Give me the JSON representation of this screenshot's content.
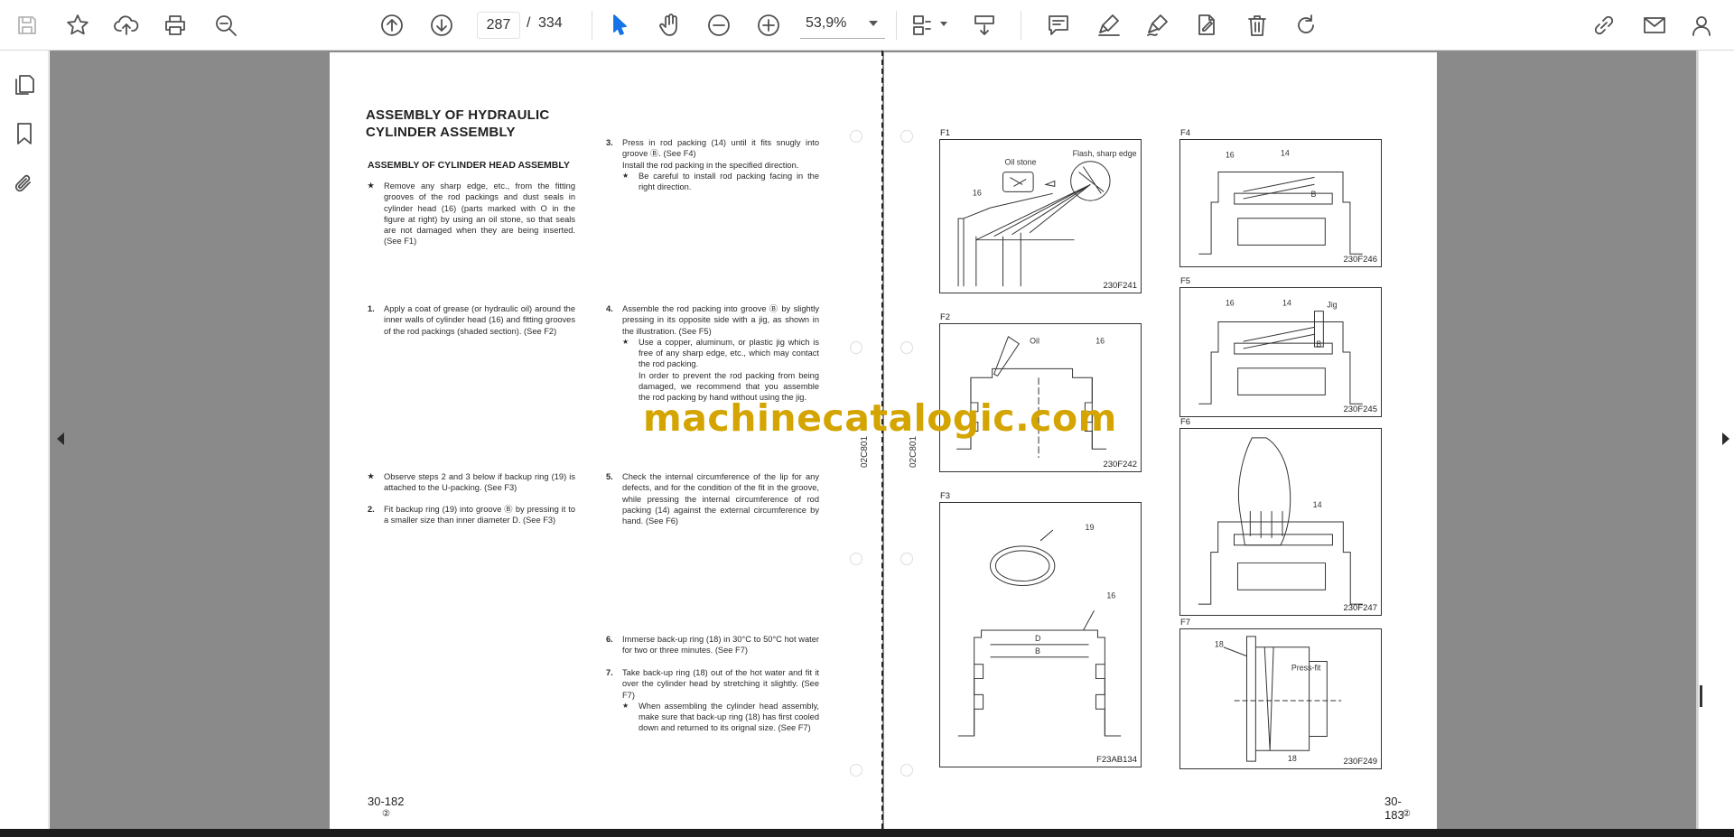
{
  "toolbar": {
    "page_current": "287",
    "page_separator": "/",
    "page_total": "334",
    "zoom": "53,9%",
    "icons": [
      "save-icon",
      "star-icon",
      "upload-icon",
      "print-icon",
      "zoom-search-icon",
      "page-up-icon",
      "page-down-icon",
      "select-cursor-icon",
      "hand-icon",
      "zoom-out-icon",
      "zoom-in-icon",
      "fit-page-icon",
      "scroll-mode-icon",
      "comment-icon",
      "highlight-icon",
      "sign-icon",
      "edit-pdf-icon",
      "delete-icon",
      "rotate-icon",
      "share-link-icon",
      "email-icon",
      "account-icon"
    ],
    "accent": "#1473e6"
  },
  "leftrail": {
    "icons": [
      "pages-icon",
      "bookmark-icon",
      "attachment-icon"
    ]
  },
  "left_page": {
    "title_line1": "ASSEMBLY OF HYDRAULIC",
    "title_line2": "CYLINDER ASSEMBLY",
    "subtitle": "ASSEMBLY OF CYLINDER HEAD ASSEMBLY",
    "note1": "Remove any sharp edge, etc., from the fitting grooves of the rod packings and dust seals in cylinder head (16) (parts marked with O in the figure at right) by using an oil stone, so that seals are not damaged when they are being inserted. (See F1)",
    "step1_num": "1.",
    "step1": "Apply a coat of grease (or hydraulic oil) around the inner walls of cylinder head (16) and fitting grooves of the rod packings (shaded section). (See F2)",
    "note2": "Observe steps 2 and 3 below if backup ring (19) is attached to the U-packing. (See F3)",
    "step2_num": "2.",
    "step2": "Fit backup ring (19) into groove Ⓑ by pressing it to a smaller size than inner diameter D. (See F3)",
    "step3_num": "3.",
    "step3": "Press in rod packing (14) until it fits snugly into groove Ⓑ. (See F4)",
    "step3_line2": "Install the rod packing in the specified direction.",
    "step3_sub": "Be careful to install rod packing facing in the right direction.",
    "step4_num": "4.",
    "step4": "Assemble the rod packing into groove Ⓑ by slightly pressing in its opposite side with a jig, as shown in the illustration. (See F5)",
    "step4_sub": "Use a copper, aluminum, or plastic jig which is free of any sharp edge, etc., which may contact the rod packing.",
    "step4_sub2": "In order to prevent the rod packing from being damaged, we recommend that you assemble the rod packing by hand without using the jig.",
    "step5_num": "5.",
    "step5": "Check the internal circumference of the lip for any defects, and for the condition of the fit in the groove, while pressing the internal circumference of rod packing (14) against the external circumference by hand. (See F6)",
    "step6_num": "6.",
    "step6": "Immerse back-up ring (18) in 30°C to 50°C hot water for two or three minutes. (See F7)",
    "step7_num": "7.",
    "step7": "Take back-up ring (18) out of the hot water and fit it over the cylinder head by stretching it slightly. (See F7)",
    "step7_sub": "When assembling the cylinder head assembly, make sure that back-up ring (18) has first cooled down and returned to its orignal size. (See F7)",
    "page_number": "30-182",
    "revision": "②",
    "vertical_code": "02C801"
  },
  "right_page": {
    "vertical_code": "02C801",
    "page_number": "30-183",
    "revision": "②",
    "figures": [
      {
        "label": "F1",
        "code": "230F241",
        "text1": "Oil stone",
        "text2": "Flash, sharp edge",
        "text3": "16"
      },
      {
        "label": "F2",
        "code": "230F242",
        "text1": "Oil",
        "text2": "16"
      },
      {
        "label": "F3",
        "code": "F23AB134",
        "text1": "19",
        "text2": "16",
        "text3": "D",
        "text4": "B"
      },
      {
        "label": "F4",
        "code": "230F246",
        "text1": "16",
        "text2": "14",
        "text3": "B"
      },
      {
        "label": "F5",
        "code": "230F245",
        "text1": "16",
        "text2": "14",
        "text3": "Jig",
        "text4": "B"
      },
      {
        "label": "F6",
        "code": "230F247",
        "text1": "14"
      },
      {
        "label": "F7",
        "code": "230F249",
        "text1": "18",
        "text2": "Press-fit",
        "text3": "18"
      }
    ]
  },
  "watermark": "machinecatalogic.com"
}
